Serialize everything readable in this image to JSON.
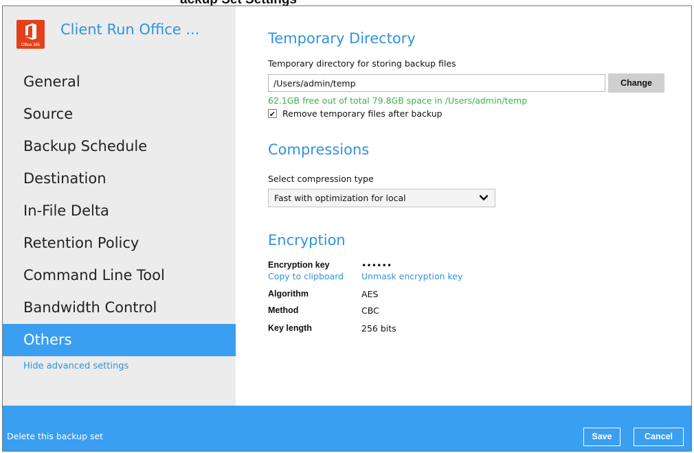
{
  "page_heading_partial": "ackup Set Settings",
  "app": {
    "logo_text": "Office 365",
    "title": "Client Run Office ..."
  },
  "nav": {
    "items": [
      {
        "label": "General"
      },
      {
        "label": "Source"
      },
      {
        "label": "Backup Schedule"
      },
      {
        "label": "Destination"
      },
      {
        "label": "In-File Delta"
      },
      {
        "label": "Retention Policy"
      },
      {
        "label": "Command Line Tool"
      },
      {
        "label": "Bandwidth Control"
      },
      {
        "label": "Others",
        "active": true
      }
    ],
    "hide_advanced": "Hide advanced settings"
  },
  "temp_dir": {
    "title": "Temporary Directory",
    "label": "Temporary directory for storing backup files",
    "path_value": "/Users/admin/temp",
    "change_label": "Change",
    "free_space": "62.1GB free out of total 79.8GB space in /Users/admin/temp",
    "remove_checked": true,
    "remove_label": "Remove temporary files after backup"
  },
  "compression": {
    "title": "Compressions",
    "label": "Select compression type",
    "selected": "Fast with optimization for local"
  },
  "encryption": {
    "title": "Encryption",
    "key_label": "Encryption key",
    "key_value": "••••••",
    "copy_link": "Copy to clipboard",
    "unmask_link": "Unmask encryption key",
    "algorithm_label": "Algorithm",
    "algorithm_value": "AES",
    "method_label": "Method",
    "method_value": "CBC",
    "key_length_label": "Key length",
    "key_length_value": "256 bits"
  },
  "footer": {
    "delete_label": "Delete this backup set",
    "save_label": "Save",
    "cancel_label": "Cancel"
  },
  "colors": {
    "accent": "#3a9ef1",
    "link": "#2f93dc",
    "success": "#37b24d",
    "logo": "#e2411a"
  },
  "icons": {
    "logo": "office-365-logo",
    "dropdown": "chevron-down-icon",
    "checkbox": "checkmark-icon"
  }
}
